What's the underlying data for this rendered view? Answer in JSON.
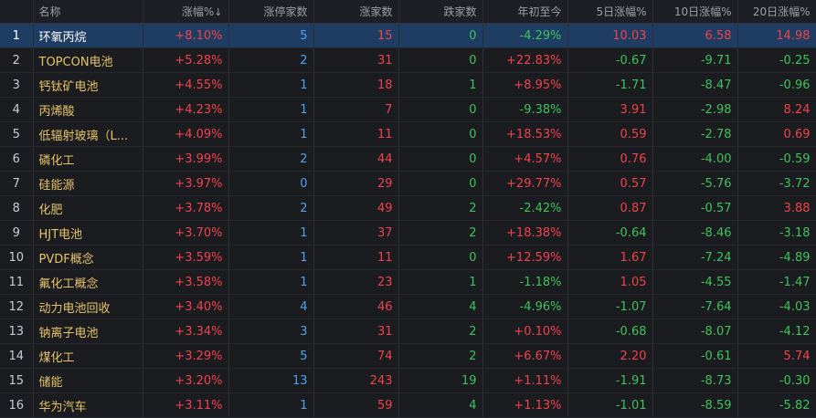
{
  "headers": {
    "name": "名称",
    "pct": "涨幅%",
    "sort_mark": "↓",
    "limit_up": "涨停家数",
    "up": "涨家数",
    "down": "跌家数",
    "ytd": "年初至今",
    "d5": "5日涨幅%",
    "d10": "10日涨幅%",
    "d20": "20日涨幅%"
  },
  "rows": [
    {
      "idx": "1",
      "name": "环氧丙烷",
      "pct": "+8.10%",
      "limit_up": "5",
      "up": "15",
      "down": "0",
      "ytd": "-4.29%",
      "d5": "10.03",
      "d10": "6.58",
      "d20": "14.98"
    },
    {
      "idx": "2",
      "name": "TOPCON电池",
      "pct": "+5.28%",
      "limit_up": "2",
      "up": "31",
      "down": "0",
      "ytd": "+22.83%",
      "d5": "-0.67",
      "d10": "-9.71",
      "d20": "-0.25"
    },
    {
      "idx": "3",
      "name": "钙钛矿电池",
      "pct": "+4.55%",
      "limit_up": "1",
      "up": "18",
      "down": "1",
      "ytd": "+8.95%",
      "d5": "-1.71",
      "d10": "-8.47",
      "d20": "-0.96"
    },
    {
      "idx": "4",
      "name": "丙烯酸",
      "pct": "+4.23%",
      "limit_up": "1",
      "up": "7",
      "down": "0",
      "ytd": "-9.38%",
      "d5": "3.91",
      "d10": "-2.98",
      "d20": "8.24"
    },
    {
      "idx": "5",
      "name": "低辐射玻璃（L...",
      "pct": "+4.09%",
      "limit_up": "1",
      "up": "11",
      "down": "0",
      "ytd": "+18.53%",
      "d5": "0.59",
      "d10": "-2.78",
      "d20": "0.69"
    },
    {
      "idx": "6",
      "name": "磷化工",
      "pct": "+3.99%",
      "limit_up": "2",
      "up": "44",
      "down": "0",
      "ytd": "+4.57%",
      "d5": "0.76",
      "d10": "-4.00",
      "d20": "-0.59"
    },
    {
      "idx": "7",
      "name": "硅能源",
      "pct": "+3.97%",
      "limit_up": "0",
      "up": "29",
      "down": "0",
      "ytd": "+29.77%",
      "d5": "0.57",
      "d10": "-5.76",
      "d20": "-3.72"
    },
    {
      "idx": "8",
      "name": "化肥",
      "pct": "+3.78%",
      "limit_up": "2",
      "up": "49",
      "down": "2",
      "ytd": "-2.42%",
      "d5": "0.87",
      "d10": "-0.57",
      "d20": "3.88"
    },
    {
      "idx": "9",
      "name": "HJT电池",
      "pct": "+3.70%",
      "limit_up": "1",
      "up": "37",
      "down": "2",
      "ytd": "+18.38%",
      "d5": "-0.64",
      "d10": "-8.46",
      "d20": "-3.18"
    },
    {
      "idx": "10",
      "name": "PVDF概念",
      "pct": "+3.59%",
      "limit_up": "1",
      "up": "11",
      "down": "0",
      "ytd": "+12.59%",
      "d5": "1.67",
      "d10": "-7.24",
      "d20": "-4.89"
    },
    {
      "idx": "11",
      "name": "氟化工概念",
      "pct": "+3.58%",
      "limit_up": "1",
      "up": "23",
      "down": "1",
      "ytd": "-1.18%",
      "d5": "1.05",
      "d10": "-4.55",
      "d20": "-1.47"
    },
    {
      "idx": "12",
      "name": "动力电池回收",
      "pct": "+3.40%",
      "limit_up": "4",
      "up": "46",
      "down": "4",
      "ytd": "-4.96%",
      "d5": "-1.07",
      "d10": "-7.64",
      "d20": "-4.03"
    },
    {
      "idx": "13",
      "name": "钠离子电池",
      "pct": "+3.34%",
      "limit_up": "3",
      "up": "31",
      "down": "2",
      "ytd": "+0.10%",
      "d5": "-0.68",
      "d10": "-8.07",
      "d20": "-4.12"
    },
    {
      "idx": "14",
      "name": "煤化工",
      "pct": "+3.29%",
      "limit_up": "5",
      "up": "74",
      "down": "2",
      "ytd": "+6.67%",
      "d5": "2.20",
      "d10": "-0.61",
      "d20": "5.74"
    },
    {
      "idx": "15",
      "name": "储能",
      "pct": "+3.20%",
      "limit_up": "13",
      "up": "243",
      "down": "19",
      "ytd": "+1.11%",
      "d5": "-1.91",
      "d10": "-8.73",
      "d20": "-0.30"
    },
    {
      "idx": "16",
      "name": "华为汽车",
      "pct": "+3.11%",
      "limit_up": "1",
      "up": "59",
      "down": "4",
      "ytd": "+1.13%",
      "d5": "-1.01",
      "d10": "-8.59",
      "d20": "-5.82"
    }
  ],
  "selected_row": 0,
  "colors": {
    "up": "#f0424c",
    "down": "#3fc25a",
    "limit": "#4ea3f0",
    "name": "#e6c36a",
    "selection": "#1f3d62"
  }
}
